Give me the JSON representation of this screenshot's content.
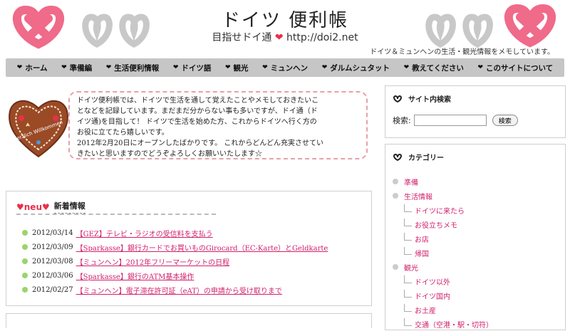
{
  "header": {
    "title": "ドイツ 便利帳",
    "subtitle_prefix": "目指せドイ通",
    "subtitle_url": "http://doi2.net",
    "description": "ドイツ＆ミュンヘンの生活・観光情報をメモしています。"
  },
  "colors": {
    "pink": "#e8304a",
    "link": "#d0206c",
    "nav_bg": "#c6c6c6",
    "news_dot": "#9bd46b",
    "category_dot": "#cccccc"
  },
  "nav": [
    "ホーム",
    "準備編",
    "生活便利情報",
    "ドイツ語",
    "観光",
    "ミュンヘン",
    "ダルムシュタット",
    "教えてください",
    "このサイトについて"
  ],
  "intro": {
    "lines": [
      "ドイツ便利帳では、ドイツで生活を通して覚えたことやメモしておきたいこ",
      "となどを記録しています。まだまだ分からない事も多いですが、ドイ通（ド",
      "イツ通)を目指して！ ドイツで生活を始めた方、これからドイツへ行く方の",
      "お役に立てたら嬉しいです。",
      "2012年2月20日にオープンしたばかりです。 これからどんどん充実させてい",
      "きたいと思いますのでどうぞよろしくお願いいたします☆"
    ],
    "gingerbread_text": "Herzlich Willkommen"
  },
  "news": {
    "badge": "♥neu♥",
    "title": "新着情報",
    "items": [
      {
        "date": "2012/03/14",
        "link": "【GEZ】テレビ・ラジオの受信料を支払う"
      },
      {
        "date": "2012/03/09",
        "link": "【Sparkasse】銀行カードでお買いものGirocard（EC-Karte）とGeldkarte"
      },
      {
        "date": "2012/03/08",
        "link": "【ミュンヘン】2012年フリーマーケットの日程"
      },
      {
        "date": "2012/03/06",
        "link": "【Sparkasse】銀行のATM基本操作"
      },
      {
        "date": "2012/02/27",
        "link": "【ミュンヘン】電子滞在許可証（eAT）の申請から受け取りまで"
      }
    ]
  },
  "sidebar": {
    "search": {
      "title": "サイト内検索",
      "label": "検索:",
      "button": "検索",
      "value": ""
    },
    "categories": {
      "title": "カテゴリー",
      "items": [
        {
          "level": 0,
          "label": "準備"
        },
        {
          "level": 0,
          "label": "生活情報"
        },
        {
          "level": 1,
          "label": "ドイツに来たら"
        },
        {
          "level": 1,
          "label": "お役立ちメモ"
        },
        {
          "level": 1,
          "label": "お店"
        },
        {
          "level": 1,
          "label": "帰国"
        },
        {
          "level": 0,
          "label": "観光"
        },
        {
          "level": 1,
          "label": "ドイツ以外"
        },
        {
          "level": 1,
          "label": "ドイツ国内"
        },
        {
          "level": 1,
          "label": "お土産"
        },
        {
          "level": 1,
          "label": "交通（空港・駅・切符）"
        }
      ]
    }
  }
}
